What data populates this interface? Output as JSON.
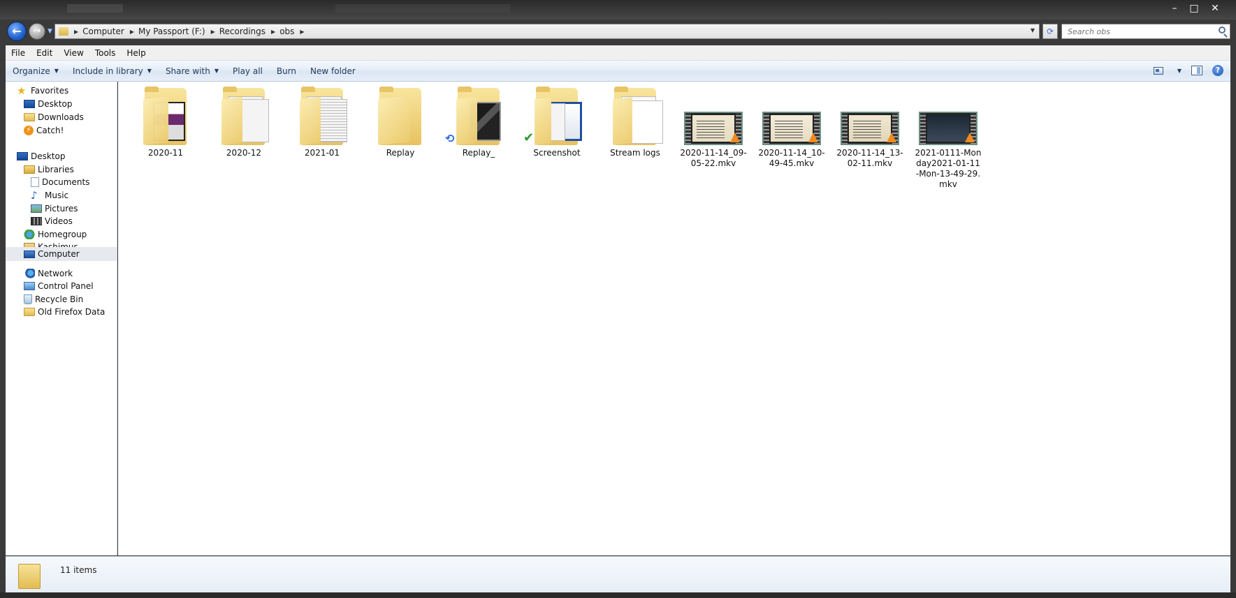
{
  "window": {
    "controls": [
      "–",
      "□",
      "✕"
    ]
  },
  "nav": {
    "breadcrumb": [
      "Computer",
      "My Passport (F:)",
      "Recordings",
      "obs"
    ],
    "search_placeholder": "Search obs"
  },
  "menu": [
    "File",
    "Edit",
    "View",
    "Tools",
    "Help"
  ],
  "command_bar": {
    "organize": "Organize",
    "include_in_library": "Include in library",
    "share_with": "Share with",
    "play_all": "Play all",
    "burn": "Burn",
    "new_folder": "New folder"
  },
  "sidebar": {
    "items": [
      {
        "label": "Favorites",
        "icon": "star-icon"
      },
      {
        "label": "Desktop",
        "icon": "desktop-icon"
      },
      {
        "label": "Downloads",
        "icon": "folder-icon"
      },
      {
        "label": "Catch!",
        "icon": "catch-icon"
      },
      {
        "label": "Desktop",
        "icon": "desktop-icon"
      },
      {
        "label": "Libraries",
        "icon": "library-icon"
      },
      {
        "label": "Documents",
        "icon": "document-icon"
      },
      {
        "label": "Music",
        "icon": "music-icon"
      },
      {
        "label": "Pictures",
        "icon": "pictures-icon"
      },
      {
        "label": "Videos",
        "icon": "video-icon"
      },
      {
        "label": "Homegroup",
        "icon": "homegroup-icon"
      },
      {
        "label": "Kashimus",
        "icon": "user-folder-icon"
      },
      {
        "label": "Computer",
        "icon": "computer-icon"
      },
      {
        "label": "Network",
        "icon": "network-icon"
      },
      {
        "label": "Control Panel",
        "icon": "control-panel-icon"
      },
      {
        "label": "Recycle Bin",
        "icon": "recycle-bin-icon"
      },
      {
        "label": "Old Firefox Data",
        "icon": "folder-icon"
      }
    ],
    "selected": "Computer"
  },
  "files": [
    {
      "name": "2020-11",
      "type": "folder"
    },
    {
      "name": "2020-12",
      "type": "folder"
    },
    {
      "name": "2021-01",
      "type": "folder"
    },
    {
      "name": "Replay",
      "type": "folder"
    },
    {
      "name": "Replay_",
      "type": "folder"
    },
    {
      "name": "Screenshot",
      "type": "folder"
    },
    {
      "name": "Stream logs",
      "type": "folder"
    },
    {
      "name": "2020-11-14_09-05-22.mkv",
      "type": "video"
    },
    {
      "name": "2020-11-14_10-49-45.mkv",
      "type": "video"
    },
    {
      "name": "2020-11-14_13-02-11.mkv",
      "type": "video"
    },
    {
      "name": "2021-0111-Monday2021-01-11-Mon-13-49-29.mkv",
      "type": "video"
    }
  ],
  "status": {
    "count": "11 items"
  },
  "colors": {
    "accent": "#1e395b",
    "selection": "#e6e9ee",
    "folder": "#e8c262"
  }
}
